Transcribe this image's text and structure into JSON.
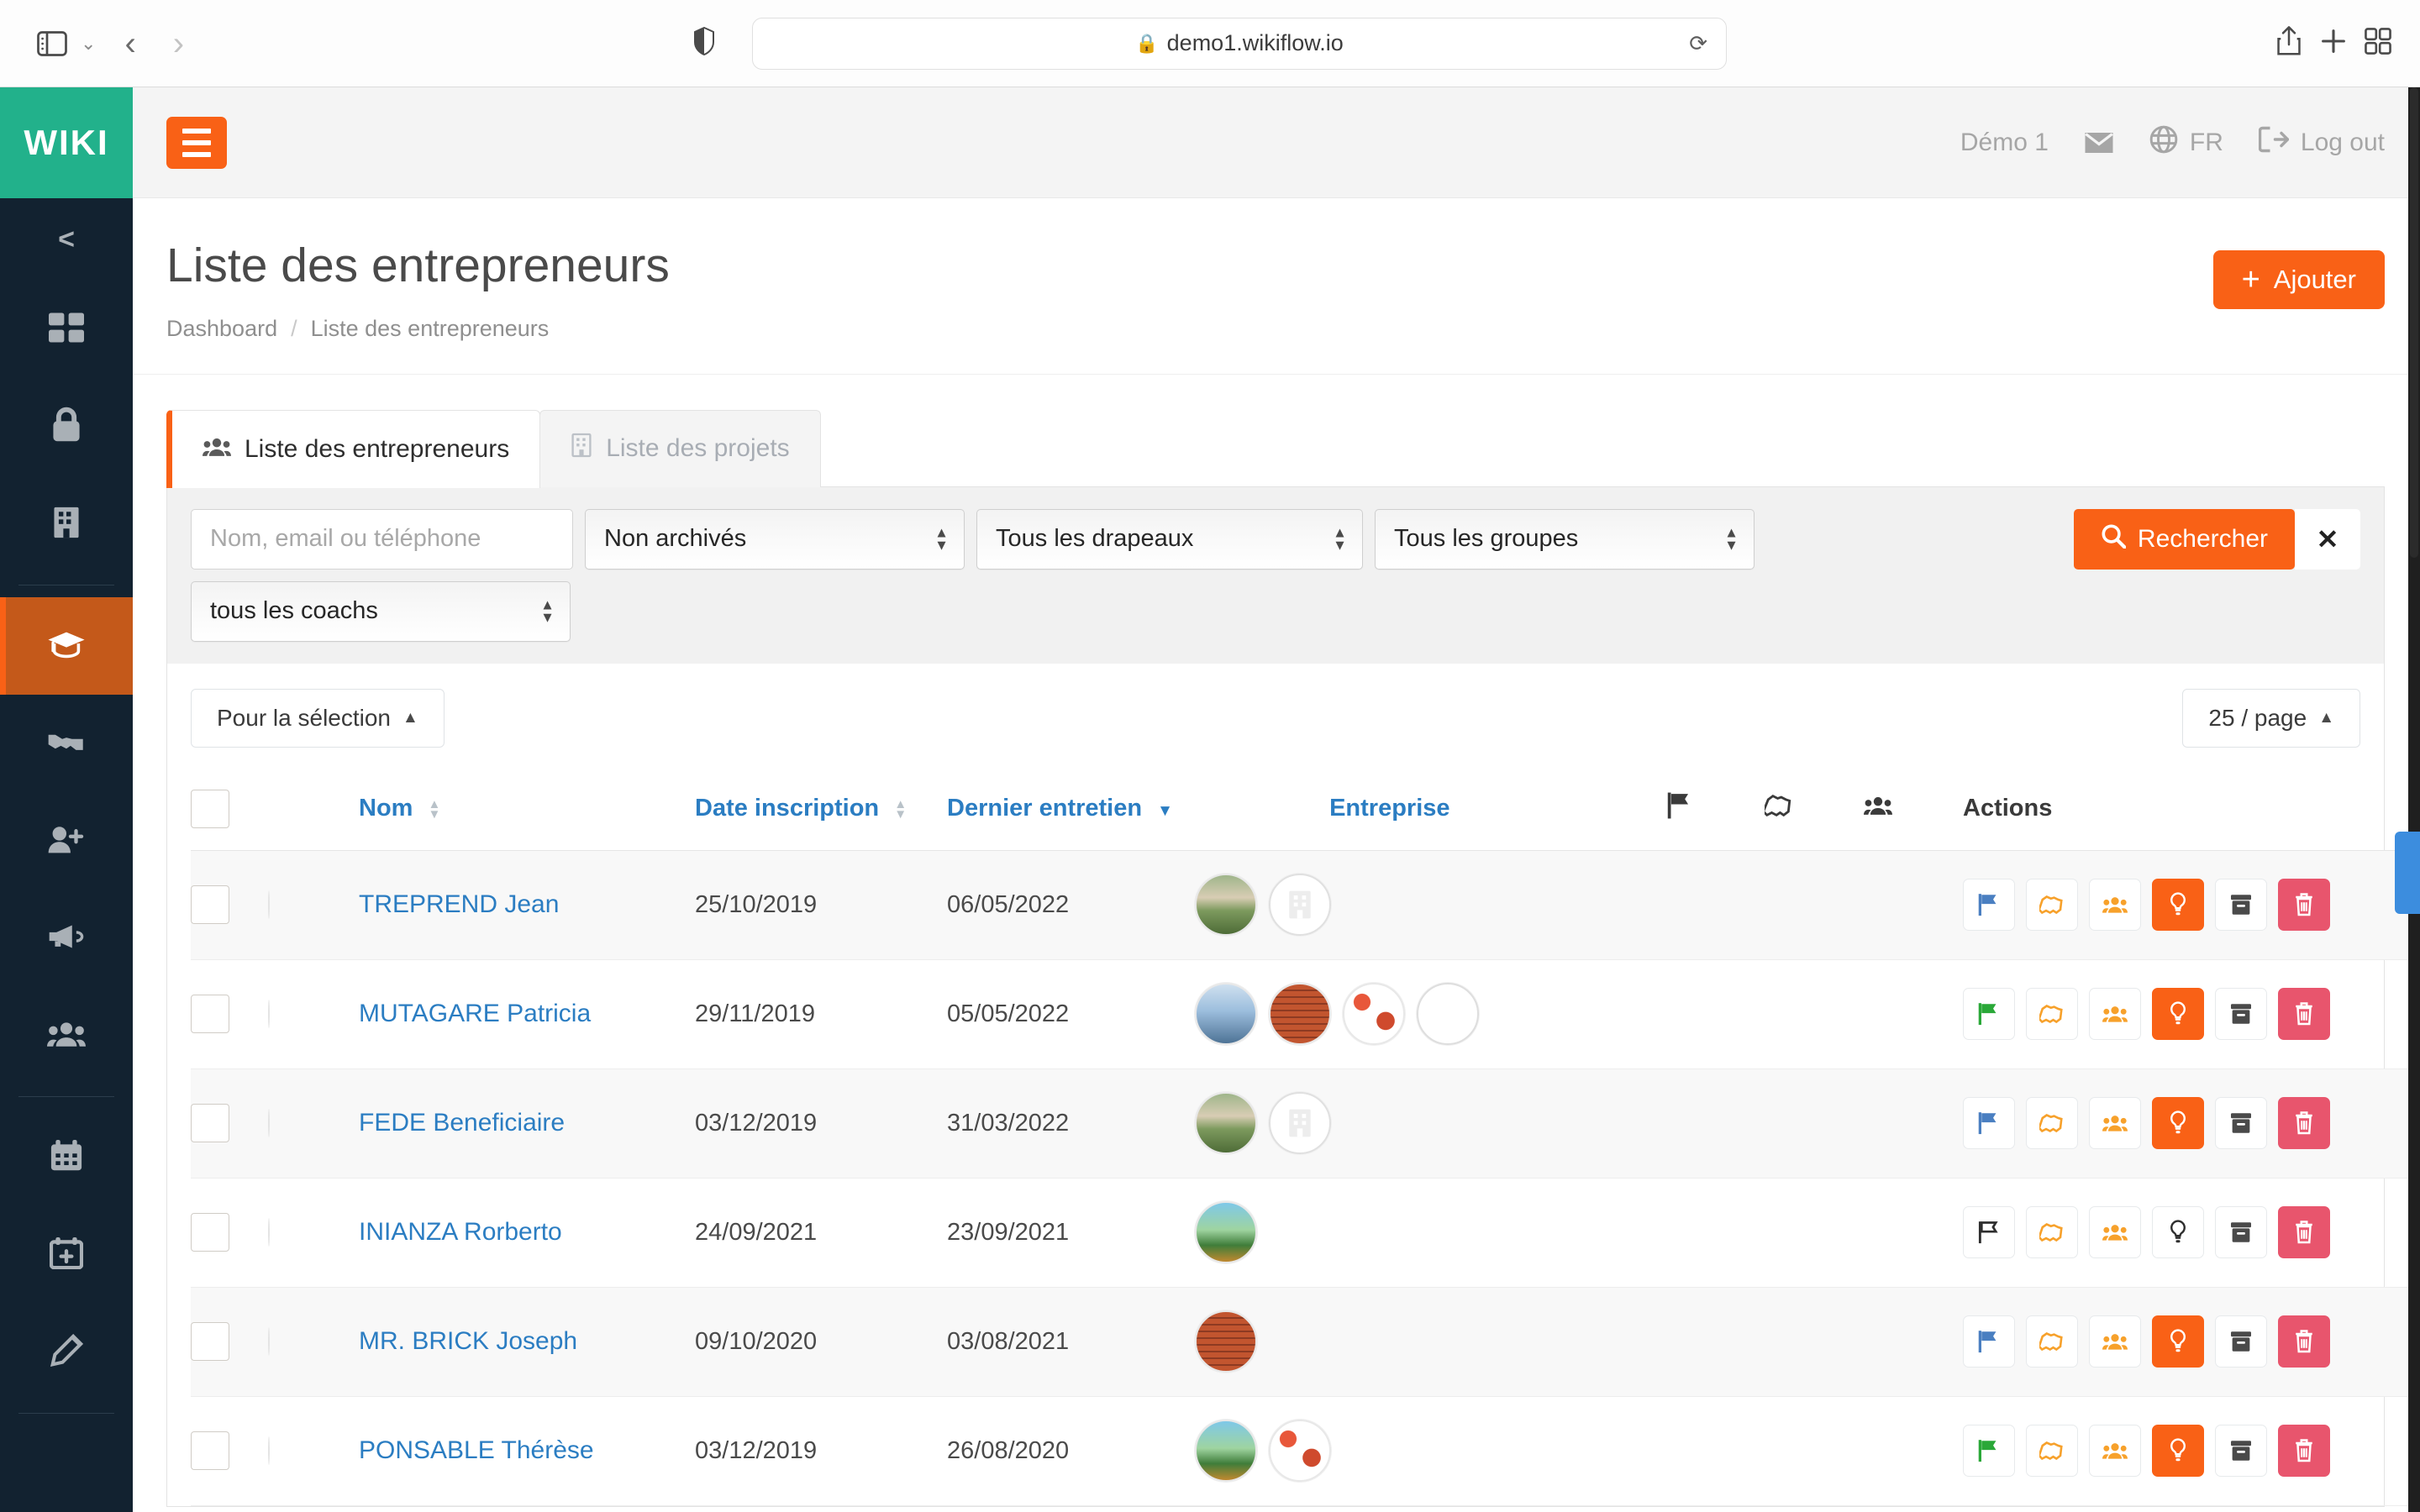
{
  "browser": {
    "url": "demo1.wikiflow.io",
    "lock_icon": "lock-icon",
    "sidebar_toggle_icon": "sidebar-toggle-icon",
    "back_icon": "back-arrow-icon",
    "forward_icon": "forward-arrow-icon",
    "shield_icon": "privacy-shield-icon",
    "reload_icon": "reload-icon",
    "share_icon": "share-icon",
    "new_tab_icon": "plus-icon",
    "tab_overview_icon": "tab-overview-icon"
  },
  "sidebar": {
    "logo": "WIKI",
    "collapse_icon": "chevron-left-icon",
    "items": [
      {
        "name": "dashboard",
        "icon": "grid-icon",
        "active": false
      },
      {
        "name": "security",
        "icon": "lock-icon",
        "active": false
      },
      {
        "name": "organisations",
        "icon": "building-icon",
        "active": false
      },
      {
        "name": "formation",
        "icon": "graduation-cap-icon",
        "active": true
      },
      {
        "name": "partenaires",
        "icon": "handshake-icon",
        "active": false
      },
      {
        "name": "ajouter-utilisateur",
        "icon": "user-plus-icon",
        "active": false
      },
      {
        "name": "annonces",
        "icon": "megaphone-icon",
        "active": false
      },
      {
        "name": "groupes",
        "icon": "users-icon",
        "active": false
      },
      {
        "name": "calendrier",
        "icon": "calendar-icon",
        "active": false
      },
      {
        "name": "nouvel-evenement",
        "icon": "calendar-plus-icon",
        "active": false
      },
      {
        "name": "editer",
        "icon": "pencil-icon",
        "active": false
      }
    ]
  },
  "topbar": {
    "menu_icon": "hamburger-icon",
    "user": "Démo 1",
    "mail_icon": "envelope-icon",
    "globe_icon": "globe-icon",
    "language": "FR",
    "logout_icon": "logout-icon",
    "logout": "Log out"
  },
  "page": {
    "title": "Liste des entrepreneurs",
    "breadcrumb": [
      "Dashboard",
      "Liste des entrepreneurs"
    ],
    "breadcrumb_separator": "/",
    "add_button": "Ajouter",
    "add_icon": "plus-icon"
  },
  "tabs": [
    {
      "label": "Liste des entrepreneurs",
      "icon": "users-icon",
      "active": true
    },
    {
      "label": "Liste des projets",
      "icon": "building-icon",
      "active": false
    }
  ],
  "filters": {
    "search_placeholder": "Nom, email ou téléphone",
    "search_value": "",
    "archived": "Non archivés",
    "flags": "Tous les drapeaux",
    "groups": "Tous les groupes",
    "coaches": "tous les coachs",
    "search_button": "Rechercher",
    "search_icon": "search-icon",
    "clear_button": "✕"
  },
  "toolbar": {
    "selection_label": "Pour la sélection",
    "per_page_label": "25 / page",
    "caret_icon": "caret-up-icon"
  },
  "table": {
    "columns": {
      "checkbox": "",
      "avatar": "",
      "name": "Nom",
      "date_inscription": "Date inscription",
      "dernier_entretien": "Dernier entretien",
      "entreprise": "Entreprise",
      "flag": "flag-icon",
      "handshake": "handshake-icon",
      "groups": "users-icon",
      "actions": "Actions"
    },
    "sort": {
      "column": "Dernier entretien",
      "direction": "desc"
    },
    "rows": [
      {
        "name": "TREPREND Jean",
        "date_inscription": "25/10/2019",
        "dernier_entretien": "06/05/2022",
        "avatar": "#7a8a9a",
        "companies": [
          "mushroom",
          "placeholder"
        ],
        "flag": "blue",
        "lightbulb_active": true
      },
      {
        "name": "MUTAGARE Patricia",
        "date_inscription": "29/11/2019",
        "dernier_entretien": "05/05/2022",
        "avatar": "#8a7264",
        "companies": [
          "fishbowl",
          "brickwall",
          "bricks",
          "empty"
        ],
        "flag": "green",
        "lightbulb_active": true
      },
      {
        "name": "FEDE Beneficiaire",
        "date_inscription": "03/12/2019",
        "dernier_entretien": "31/03/2022",
        "avatar": "#4c4742",
        "companies": [
          "mushroom",
          "placeholder"
        ],
        "flag": "blue",
        "lightbulb_active": true
      },
      {
        "name": "INIANZA Rorberto",
        "date_inscription": "24/09/2021",
        "dernier_entretien": "23/09/2021",
        "avatar": "#b79a7e",
        "companies": [
          "naturapark"
        ],
        "flag": "none",
        "lightbulb_active": false
      },
      {
        "name": "MR. BRICK Joseph",
        "date_inscription": "09/10/2020",
        "dernier_entretien": "03/08/2021",
        "avatar": "#6e6e70",
        "companies": [
          "brickwall"
        ],
        "flag": "blue",
        "lightbulb_active": true
      },
      {
        "name": "PONSABLE Thérèse",
        "date_inscription": "03/12/2019",
        "dernier_entretien": "26/08/2020",
        "avatar": "#a98a6c",
        "companies": [
          "naturapark",
          "bricks"
        ],
        "flag": "green",
        "lightbulb_active": true
      }
    ],
    "action_icons": [
      "flag-icon",
      "handshake-icon",
      "users-icon",
      "lightbulb-icon",
      "archive-icon",
      "trash-icon"
    ]
  },
  "colors": {
    "brand_orange": "#f96116",
    "brand_green": "#22b18b",
    "sidebar_dark": "#122230",
    "link_blue": "#2b7dc2",
    "danger_red": "#e8556d"
  }
}
